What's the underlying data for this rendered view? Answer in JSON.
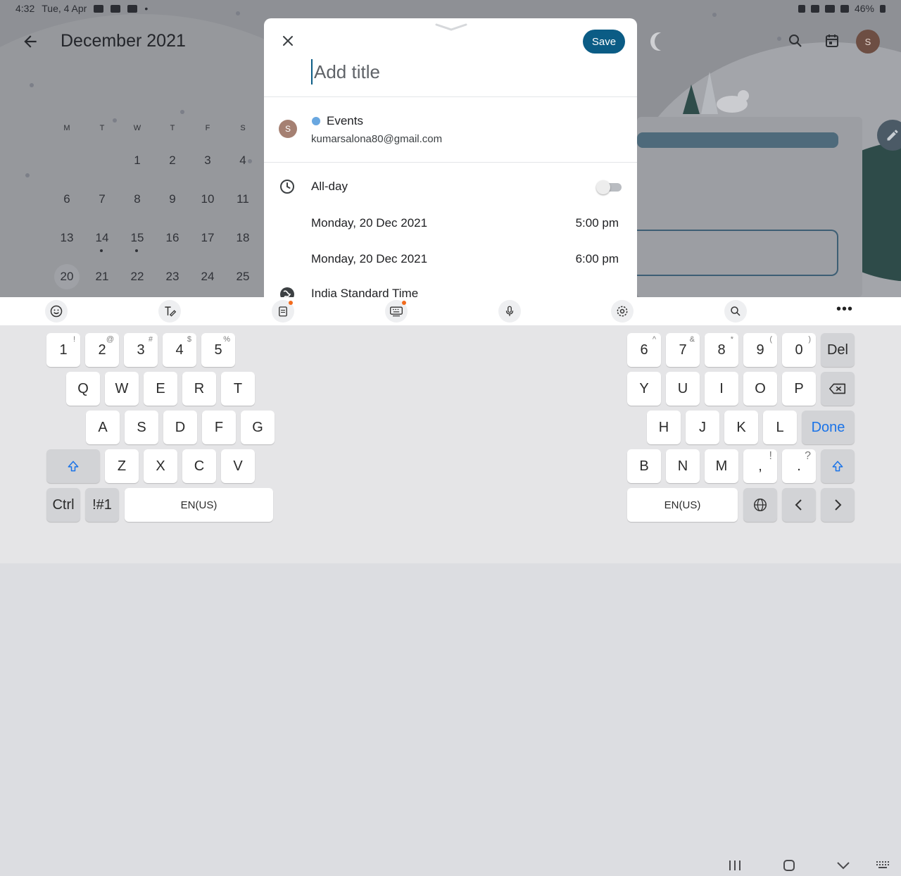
{
  "status_bar": {
    "time": "4:32",
    "date": "Tue, 4 Apr",
    "battery": "46%"
  },
  "calendar": {
    "month_title": "December 2021",
    "weekdays": [
      "M",
      "T",
      "W",
      "T",
      "F",
      "S"
    ],
    "weeks": [
      [
        "",
        "",
        "1",
        "2",
        "3",
        "4"
      ],
      [
        "6",
        "7",
        "8",
        "9",
        "10",
        "11"
      ],
      [
        "13",
        "14",
        "15",
        "16",
        "17",
        "18"
      ],
      [
        "20",
        "21",
        "22",
        "23",
        "24",
        "25"
      ]
    ],
    "selected_day": "20",
    "days_with_events": [
      "14",
      "15"
    ]
  },
  "dialog": {
    "save_label": "Save",
    "title_placeholder": "Add title",
    "account_initial": "S",
    "calendar_name": "Events",
    "calendar_color": "#69a7e0",
    "account_email": "kumarsalona80@gmail.com",
    "all_day_label": "All-day",
    "all_day_on": false,
    "start_date": "Monday, 20 Dec 2021",
    "start_time": "5:00 pm",
    "end_date": "Monday, 20 Dec 2021",
    "end_time": "6:00 pm",
    "timezone": "India Standard Time"
  },
  "avatar_initial": "S",
  "keyboard": {
    "toolbar_icons": [
      "emoji-icon",
      "handwriting-icon",
      "clipboard-icon",
      "keyboard-mode-icon",
      "microphone-icon",
      "settings-icon",
      "search-icon",
      "more-icon"
    ],
    "left": {
      "row1": [
        [
          "1",
          "!"
        ],
        [
          "2",
          "@"
        ],
        [
          "3",
          "#"
        ],
        [
          "4",
          "$"
        ],
        [
          "5",
          "%"
        ]
      ],
      "row2": [
        "Q",
        "W",
        "E",
        "R",
        "T"
      ],
      "row3": [
        "A",
        "S",
        "D",
        "F",
        "G"
      ],
      "row4": [
        "Z",
        "X",
        "C",
        "V"
      ],
      "ctrl": "Ctrl",
      "symbols": "!#1",
      "space": "EN(US)"
    },
    "right": {
      "row1": [
        [
          "6",
          "^"
        ],
        [
          "7",
          "&"
        ],
        [
          "8",
          "*"
        ],
        [
          "9",
          "("
        ],
        [
          "0",
          ")"
        ]
      ],
      "del": "Del",
      "row2": [
        "Y",
        "U",
        "I",
        "O",
        "P"
      ],
      "row3": [
        "H",
        "J",
        "K",
        "L"
      ],
      "done": "Done",
      "row4": [
        "B",
        "N",
        "M"
      ],
      "comma": [
        ",",
        "!"
      ],
      "period": [
        ".",
        "?"
      ],
      "space": "EN(US)"
    }
  },
  "accent_color": "#0b5c85"
}
